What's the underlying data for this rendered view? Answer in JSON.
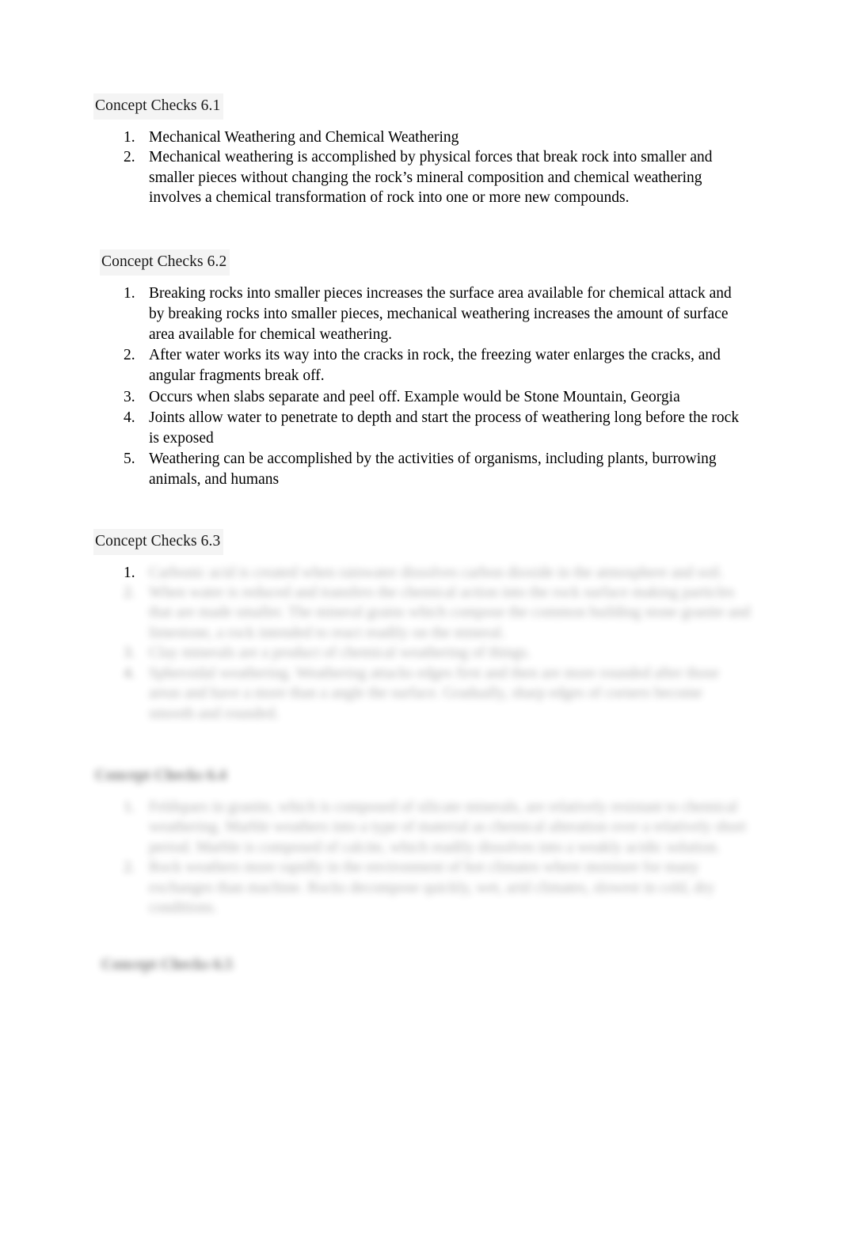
{
  "document": {
    "background_color": "#ffffff",
    "text_color": "#000000",
    "heading_highlight_color": "#f4f4f4"
  },
  "sections": [
    {
      "heading": "Concept Checks 6.1",
      "blurred_heading": false,
      "items": [
        {
          "text": "Mechanical Weathering and Chemical Weathering",
          "blurred": false
        },
        {
          "text": "Mechanical weathering is accomplished by physical forces that break rock into smaller and smaller pieces without changing the rock’s mineral composition and chemical weathering involves a chemical transformation of rock into one or more new compounds.",
          "blurred": false
        }
      ]
    },
    {
      "heading": "Concept Checks 6.2",
      "blurred_heading": false,
      "items": [
        {
          "text": "Breaking rocks into smaller pieces increases the surface area available for chemical attack and by breaking rocks into smaller pieces, mechanical weathering increases the amount of surface area available for chemical weathering.",
          "blurred": false
        },
        {
          "text": "After water works its way into the cracks in rock, the freezing water enlarges the cracks, and angular fragments break off.",
          "blurred": false
        },
        {
          "text": "Occurs when slabs separate and peel off. Example would be Stone Mountain, Georgia",
          "blurred": false
        },
        {
          "text": "Joints allow water to penetrate to depth and start the process of weathering long before the rock is exposed",
          "blurred": false
        },
        {
          "text": "Weathering can be accomplished by the activities of organisms, including plants, burrowing animals, and humans",
          "blurred": false
        }
      ]
    },
    {
      "heading": "Concept Checks 6.3",
      "blurred_heading": false,
      "items": [
        {
          "text": "Carbonic acid is created when rainwater dissolves carbon dioxide in the atmosphere and soil.",
          "blurred": true,
          "marker_sharp": true
        },
        {
          "text": "When water is reduced and transfers the chemical action into the rock surface making particles that are made smaller. The mineral grains which compose the common building stone granite and limestone, a rock intended to react readily on the mineral.",
          "blurred": true
        },
        {
          "text": "Clay minerals are a product of chemical weathering of things.",
          "blurred": true
        },
        {
          "text": "Spheroidal weathering. Weathering attacks edges first and then are more rounded after those areas and have a more than a angle the surface. Gradually, sharp edges of corners become smooth and rounded.",
          "blurred": true
        }
      ]
    },
    {
      "heading": "Concept Checks 6.4",
      "blurred_heading": true,
      "items": [
        {
          "text": "Feldspars in granite, which is composed of silicate minerals, are relatively resistant to chemical weathering. Marble weathers into a type of material as chemical alteration over a relatively short period. Marble is composed of calcite, which readily dissolves into a weakly acidic solution.",
          "blurred": true
        },
        {
          "text": "Rock weathers more rapidly in the environment of hot climates where moisture for many exchanges than machine. Rocks decompose quickly, wet, arid climates, slowest in cold, dry conditions.",
          "blurred": true
        }
      ]
    },
    {
      "heading": "Concept Checks 6.5",
      "blurred_heading": true,
      "items": []
    }
  ]
}
